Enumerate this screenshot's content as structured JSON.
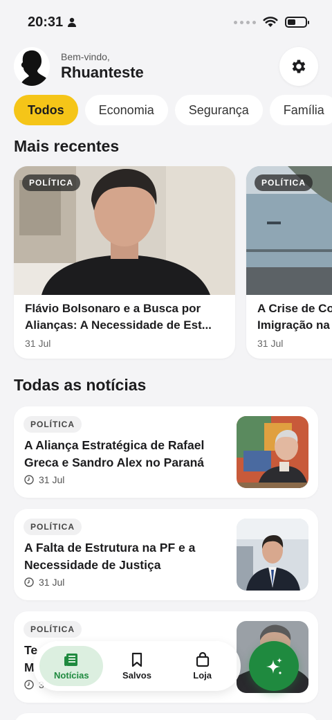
{
  "status": {
    "time": "20:31"
  },
  "header": {
    "welcome": "Bem-vindo,",
    "username": "Rhuanteste"
  },
  "categories": [
    "Todos",
    "Economia",
    "Segurança",
    "Família"
  ],
  "recent": {
    "title": "Mais recentes",
    "cards": [
      {
        "category": "POLÍTICA",
        "title": "Flávio Bolsonaro e a Busca por",
        "title2": "Alianças: A Necessidade de Est...",
        "date": "31 Jul"
      },
      {
        "category": "POLÍTICA",
        "title": "A Crise de Co",
        "title2": "Imigração na",
        "date": "31 Jul"
      }
    ]
  },
  "all_news": {
    "title": "Todas as notícias",
    "items": [
      {
        "category": "POLÍTICA",
        "title": "A Aliança Estratégica de Rafael Greca e Sandro Alex no Paraná",
        "date": "31 Jul"
      },
      {
        "category": "POLÍTICA",
        "title": "A Falta de Estrutura na PF e a Necessidade de Justiça",
        "date": "31 Jul"
      },
      {
        "category": "POLÍTICA",
        "title": "Te",
        "title2": "M",
        "date": "3"
      }
    ]
  },
  "nav": {
    "news": "Notícias",
    "saved": "Salvos",
    "store": "Loja"
  },
  "colors": {
    "accent": "#f5c518",
    "green": "#1f8a3f"
  }
}
